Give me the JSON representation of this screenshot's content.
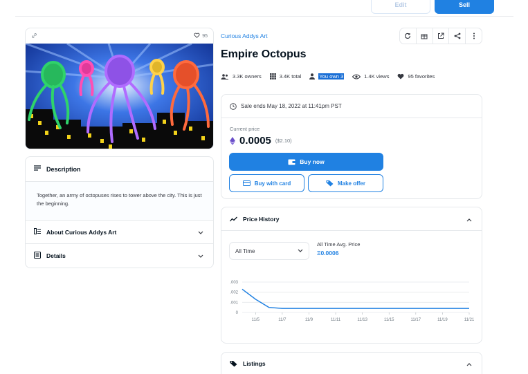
{
  "topbar": {
    "edit_label": "Edit",
    "sell_label": "Sell"
  },
  "media": {
    "favorites_count": "95"
  },
  "description": {
    "heading": "Description",
    "text": "Together, an army of octopuses rises to tower above the city. This is just the beginning.",
    "about_label": "About Curious Addys Art",
    "details_label": "Details"
  },
  "item": {
    "collection": "Curious Addys Art",
    "title": "Empire Octopus",
    "owners": "3.3K owners",
    "total": "3.4K total",
    "you_own": "You own 3",
    "views": "1.4K views",
    "favorites": "95 favorites"
  },
  "sale": {
    "ends": "Sale ends May 18, 2022 at 11:41pm PST",
    "current_price_label": "Current price",
    "price": "0.0005",
    "usd": "($2.10)",
    "buy_now": "Buy now",
    "buy_with_card": "Buy with card",
    "make_offer": "Make offer"
  },
  "price_history": {
    "heading": "Price History",
    "range_selected": "All Time",
    "avg_label": "All Time Avg. Price",
    "avg_value": "Ξ0.0006"
  },
  "listings": {
    "heading": "Listings"
  },
  "colors": {
    "accent": "#2081e2",
    "border": "#e5e8eb",
    "text": "#04111d"
  },
  "chart_data": {
    "type": "line",
    "x": [
      "11/4",
      "11/5",
      "11/6",
      "11/7",
      "11/8",
      "11/9",
      "11/10",
      "11/11",
      "11/12",
      "11/13",
      "11/14",
      "11/15",
      "11/16",
      "11/17",
      "11/18",
      "11/19",
      "11/20",
      "11/21"
    ],
    "values": [
      0.0023,
      0.0013,
      0.0005,
      0.0004,
      0.0004,
      0.0004,
      0.0004,
      0.0004,
      0.0004,
      0.0004,
      0.0004,
      0.0004,
      0.0004,
      0.0004,
      0.0004,
      0.0004,
      0.0004,
      0.0004
    ],
    "xticks": [
      "11/5",
      "11/7",
      "11/9",
      "11/11",
      "11/13",
      "11/15",
      "11/17",
      "11/19",
      "11/21"
    ],
    "yticks": [
      {
        "value": 0.003,
        "label": ".003"
      },
      {
        "value": 0.002,
        "label": ".002"
      },
      {
        "value": 0.001,
        "label": ".001"
      },
      {
        "value": 0,
        "label": "0"
      }
    ],
    "ylim": [
      0,
      0.003
    ],
    "grid": true
  }
}
